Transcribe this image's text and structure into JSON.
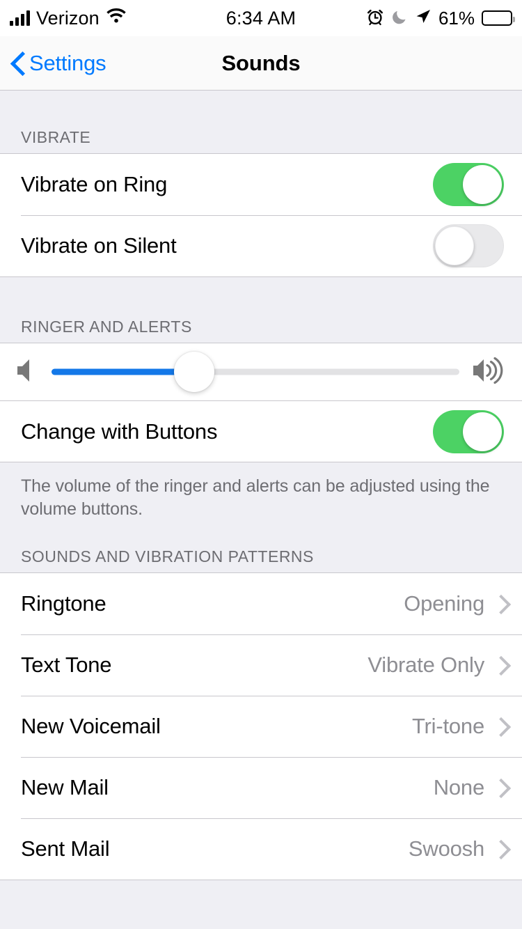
{
  "status_bar": {
    "carrier": "Verizon",
    "signal_bars": 4,
    "wifi_icon": "wifi-icon",
    "time": "6:34 AM",
    "alarm_icon": "alarm-clock-icon",
    "dnd_icon": "crescent-moon-icon",
    "location_icon": "location-arrow-icon",
    "battery_percent_label": "61%",
    "battery_level": 61
  },
  "nav": {
    "back_label": "Settings",
    "back_icon": "chevron-left-icon",
    "title": "Sounds"
  },
  "sections": {
    "vibrate": {
      "header": "VIBRATE",
      "rows": [
        {
          "label": "Vibrate on Ring",
          "toggle_state": "on"
        },
        {
          "label": "Vibrate on Silent",
          "toggle_state": "off"
        }
      ]
    },
    "ringer": {
      "header": "RINGER AND ALERTS",
      "slider": {
        "min_icon": "speaker-low-icon",
        "max_icon": "speaker-high-icon",
        "value_percent": 35
      },
      "change_with_buttons": {
        "label": "Change with Buttons",
        "toggle_state": "on"
      },
      "footer_note": "The volume of the ringer and alerts can be adjusted using the volume buttons."
    },
    "sounds_patterns": {
      "header": "SOUNDS AND VIBRATION PATTERNS",
      "rows": [
        {
          "label": "Ringtone",
          "detail": "Opening",
          "accessory": "chevron-right-icon"
        },
        {
          "label": "Text Tone",
          "detail": "Vibrate Only",
          "accessory": "chevron-right-icon"
        },
        {
          "label": "New Voicemail",
          "detail": "Tri-tone",
          "accessory": "chevron-right-icon"
        },
        {
          "label": "New Mail",
          "detail": "None",
          "accessory": "chevron-right-icon"
        },
        {
          "label": "Sent Mail",
          "detail": "Swoosh",
          "accessory": "chevron-right-icon"
        }
      ]
    }
  },
  "colors": {
    "accent_blue": "#007AFF",
    "toggle_green": "#4CD264",
    "slider_blue": "#1478E8",
    "page_background": "#EFEFF4",
    "detail_gray": "#8E8E93",
    "header_gray": "#6D6D72"
  }
}
